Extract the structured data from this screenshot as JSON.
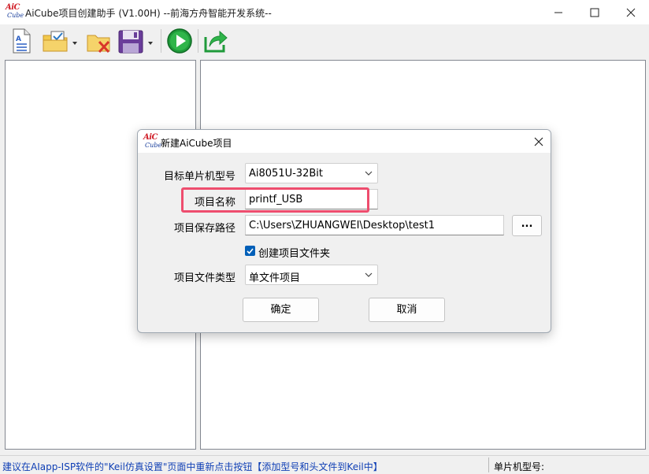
{
  "window": {
    "title": "AiCube项目创建助手 (V1.00H) --前海方舟智能开发系统--",
    "logo_top": "AiC",
    "logo_bottom": "Cube"
  },
  "toolbar": {
    "buttons": [
      "new-project-icon",
      "open-project-icon",
      "delete-project-icon",
      "save-icon",
      "run-icon",
      "export-icon"
    ]
  },
  "status": {
    "message": "建议在AIapp-ISP软件的\"Keil仿真设置\"页面中重新点击按钮【添加型号和头文件到Keil中】",
    "mcu_label": "单片机型号:"
  },
  "dialog": {
    "title": "新建AiCube项目",
    "fields": {
      "mcu_label": "目标单片机型号",
      "mcu_value": "Ai8051U-32Bit",
      "name_label": "项目名称",
      "name_value": "printf_USB",
      "path_label": "项目保存路径",
      "path_value": "C:\\Users\\ZHUANGWEI\\Desktop\\test1",
      "browse_label": "...",
      "create_folder_label": "创建项目文件夹",
      "create_folder_checked": true,
      "type_label": "项目文件类型",
      "type_value": "单文件项目"
    },
    "ok_label": "确定",
    "cancel_label": "取消"
  },
  "colors": {
    "accent": "#005fb8",
    "highlight": "#ee4d6e",
    "status_text": "#0f3fb5"
  }
}
